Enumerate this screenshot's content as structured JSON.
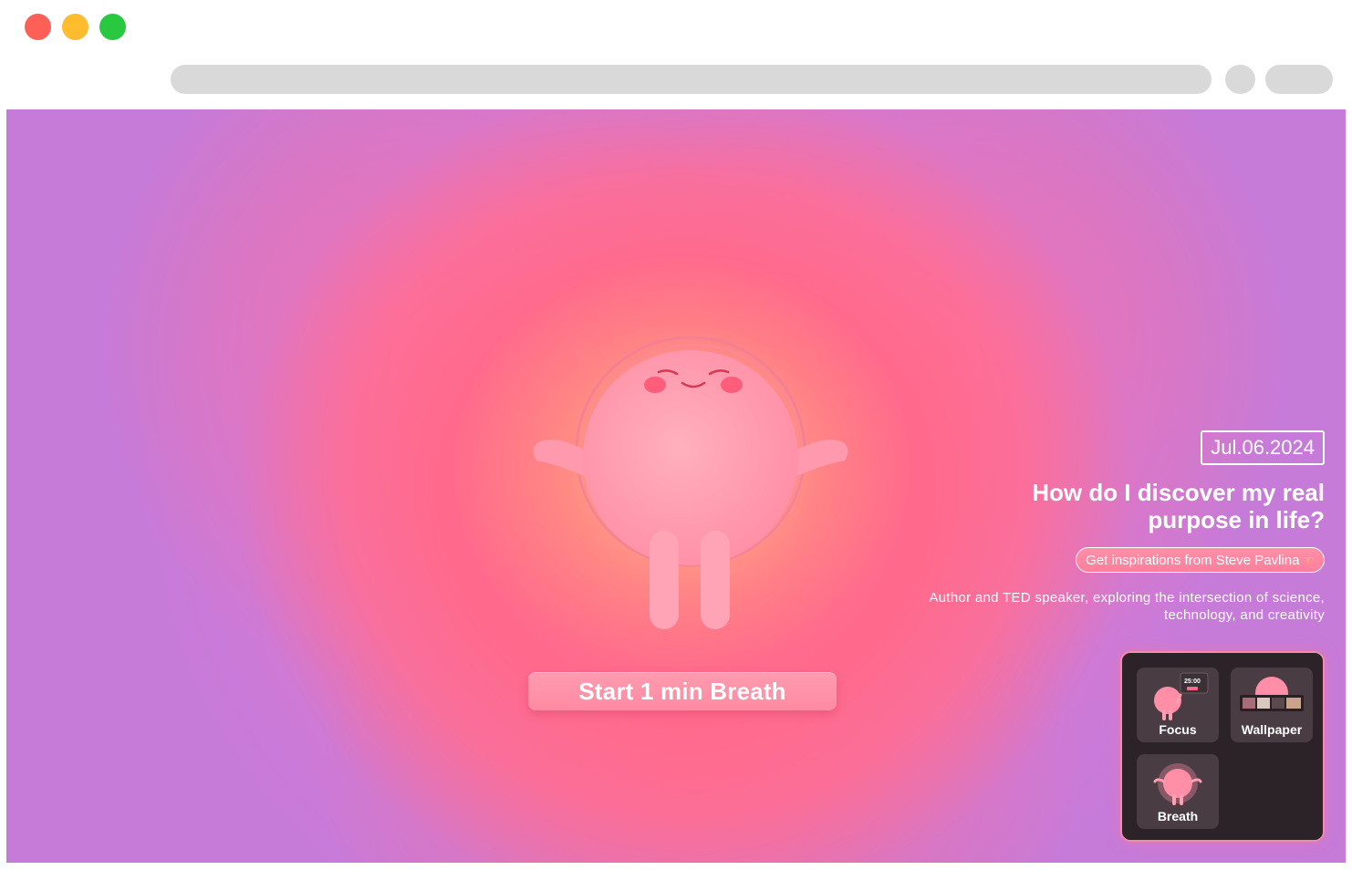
{
  "window": {
    "traffic_lights": [
      "close",
      "minimize",
      "zoom"
    ],
    "colors": {
      "close": "#fe5f57",
      "minimize": "#febc2e",
      "zoom": "#28c840"
    }
  },
  "hero": {
    "start_button": "Start 1 min Breath"
  },
  "quote": {
    "date": "Jul.06.2024",
    "question": "How do I discover my real purpose in life?",
    "inspiration_button": "Get inspirations from Steve Pavlina",
    "inspiration_icon": "pointing-hand-icon",
    "author_description": "Author and TED speaker, exploring the intersection of science, technology, and creativity"
  },
  "apps": [
    {
      "label": "Focus",
      "icon": "focus-mascot-icon",
      "timer": "25:00"
    },
    {
      "label": "Wallpaper",
      "icon": "wallpaper-mascot-icon"
    },
    {
      "label": "Breath",
      "icon": "breath-mascot-icon"
    }
  ],
  "colors": {
    "background": "#c67bd9",
    "glow": "#ff6f8e",
    "button": "#ff8aa2",
    "widget": "#2b2328"
  }
}
